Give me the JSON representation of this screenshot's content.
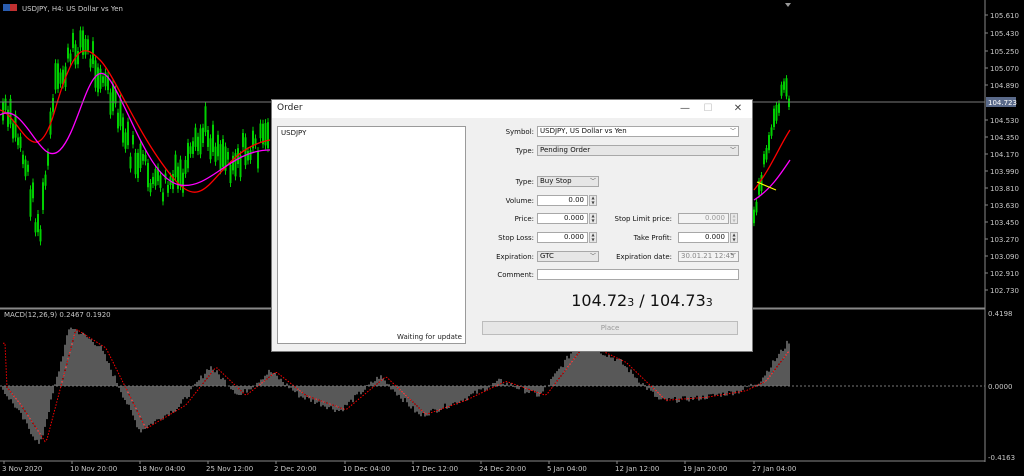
{
  "chart": {
    "symbol_title": "USDJPY, H4:  US Dollar vs Yen",
    "price_labels": [
      "105.610",
      "105.430",
      "105.250",
      "105.070",
      "104.890",
      "104.530",
      "104.350",
      "104.170",
      "103.990",
      "103.810",
      "103.630",
      "103.450",
      "103.270",
      "103.090",
      "102.910",
      "102.730"
    ],
    "current_price_label": "104.723",
    "macd_label": "MACD(12,26,9) 0.2467 0.1920",
    "macd_scale": [
      "0.4198",
      "0.0000",
      "-0.4163"
    ],
    "time_labels": [
      "3 Nov 2020",
      "10 Nov 20:00",
      "18 Nov 04:00",
      "25 Nov 12:00",
      "2 Dec 20:00",
      "10 Dec 04:00",
      "17 Dec 12:00",
      "24 Dec 20:00",
      "5 Jan 04:00",
      "12 Jan 12:00",
      "19 Jan 20:00",
      "27 Jan 04:00"
    ],
    "colors": {
      "bull": "#00d000",
      "fast_ma": "#ff0000",
      "slow_ma": "#ff00ff",
      "signal": "#ff0000",
      "hist": "#b0b0b0"
    }
  },
  "dialog": {
    "title": "Order",
    "window_buttons": {
      "minimize": "—",
      "maximize": "☐",
      "close": "✕"
    },
    "symbol_list_title": "USDJPY",
    "symbol_list_status": "Waiting for update",
    "fields": {
      "symbol_label": "Symbol:",
      "symbol_value": "USDJPY, US Dollar vs Yen",
      "type_label": "Type:",
      "type_value": "Pending Order",
      "order_type_label": "Type:",
      "order_type_value": "Buy Stop",
      "volume_label": "Volume:",
      "volume_value": "0.00",
      "price_label": "Price:",
      "price_value": "0.000",
      "stop_limit_label": "Stop Limit price:",
      "stop_limit_value": "0.000",
      "stop_loss_label": "Stop Loss:",
      "stop_loss_value": "0.000",
      "take_profit_label": "Take Profit:",
      "take_profit_value": "0.000",
      "expiration_label": "Expiration:",
      "expiration_value": "GTC",
      "expiration_date_label": "Expiration date:",
      "expiration_date_value": "30.01.21 12:45",
      "comment_label": "Comment:",
      "comment_value": ""
    },
    "bid_main": "104.72",
    "bid_small": "3",
    "separator": " / ",
    "ask_main": "104.73",
    "ask_small": "3",
    "place_label": "Place"
  }
}
